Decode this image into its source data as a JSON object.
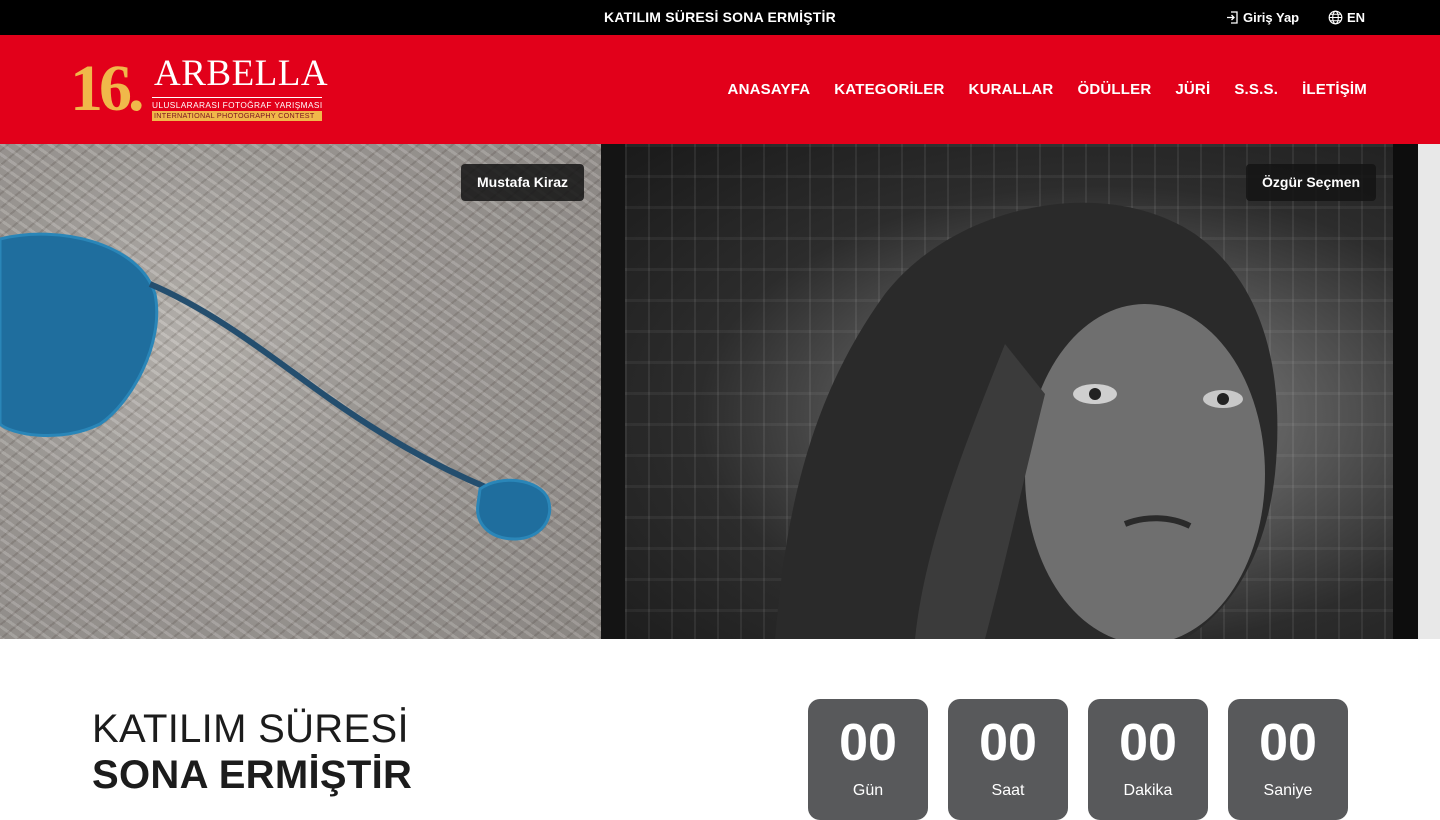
{
  "topbar": {
    "notice": "KATILIM SÜRESİ SONA ERMİŞTİR",
    "login_label": "Giriş Yap",
    "login_icon": "login-icon",
    "language_label": "EN",
    "language_icon": "globe-icon"
  },
  "logo": {
    "number": "16",
    "brand": "ARBELLA",
    "subtitle_tr": "ULUSLARARASI FOTOĞRAF YARIŞMASI",
    "subtitle_en": "INTERNATIONAL PHOTOGRAPHY CONTEST"
  },
  "nav": {
    "items": [
      {
        "label": "ANASAYFA"
      },
      {
        "label": "KATEGORİLER"
      },
      {
        "label": "KURALLAR"
      },
      {
        "label": "ÖDÜLLER"
      },
      {
        "label": "JÜRİ"
      },
      {
        "label": "S.S.S."
      },
      {
        "label": "İLETİŞİM"
      }
    ]
  },
  "hero": {
    "photos": [
      {
        "credit": "Mustafa Kiraz"
      },
      {
        "credit": "Özgür Seçmen"
      }
    ]
  },
  "countdown": {
    "title_line1": "KATILIM SÜRESİ",
    "title_line2": "SONA ERMİŞTİR",
    "units": [
      {
        "value": "00",
        "label": "Gün"
      },
      {
        "value": "00",
        "label": "Saat"
      },
      {
        "value": "00",
        "label": "Dakika"
      },
      {
        "value": "00",
        "label": "Saniye"
      }
    ]
  },
  "colors": {
    "brand_red": "#e2001a",
    "gold": "#f0b84a",
    "counter_bg": "#58595b"
  }
}
